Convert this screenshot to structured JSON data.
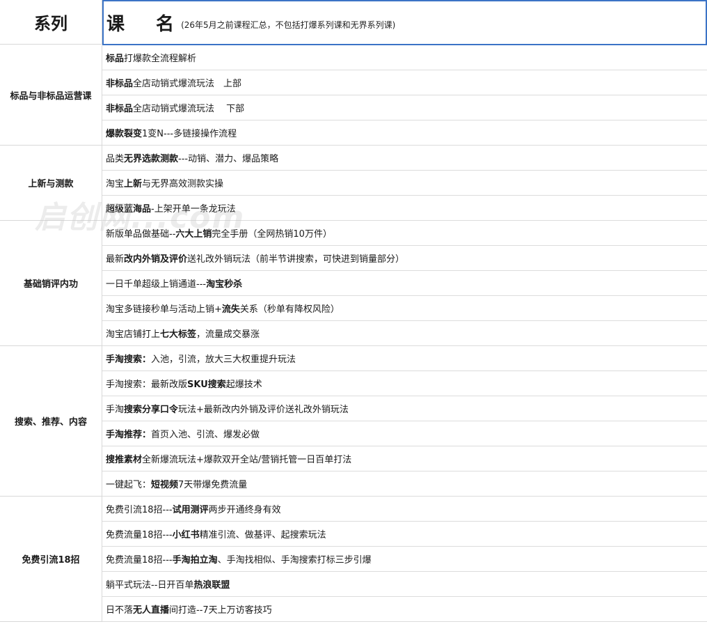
{
  "header": {
    "series_label": "系列",
    "course_label": "课 名",
    "course_note": "(26年5月之前课程汇总，不包括打爆系列课和无界系列课)"
  },
  "watermark": "启创网...com",
  "groups": [
    {
      "name": "标品与非标品运营课",
      "rows": [
        [
          {
            "t": "标品",
            "b": true
          },
          {
            "t": "打爆款全流程解析"
          }
        ],
        [
          {
            "t": "非标品",
            "b": true
          },
          {
            "t": "全店动销式爆流玩法　上部"
          }
        ],
        [
          {
            "t": "非标品",
            "b": true
          },
          {
            "t": "全店动销式爆流玩法　 下部"
          }
        ],
        [
          {
            "t": "爆款裂变",
            "b": true
          },
          {
            "t": "1变N---多链接操作流程"
          }
        ]
      ]
    },
    {
      "name": "上新与测款",
      "rows": [
        [
          {
            "t": "品类"
          },
          {
            "t": "无界选款测款",
            "b": true
          },
          {
            "t": "---动销、潜力、爆品策略"
          }
        ],
        [
          {
            "t": "淘宝"
          },
          {
            "t": "上新",
            "b": true
          },
          {
            "t": "与无界高效测款实操"
          }
        ],
        [
          {
            "t": "超级蓝海品",
            "b": true
          },
          {
            "t": "-上架开单一条龙玩法"
          }
        ]
      ]
    },
    {
      "name": "基础销评内功",
      "rows": [
        [
          {
            "t": "新版单品做基础--"
          },
          {
            "t": "六大上销",
            "b": true
          },
          {
            "t": "完全手册（全网热销10万件）"
          }
        ],
        [
          {
            "t": "最新"
          },
          {
            "t": "改内外销及评价",
            "b": true
          },
          {
            "t": "送礼改外销玩法（前半节讲搜索，可快进到销量部分）"
          }
        ],
        [
          {
            "t": "一日千单超级上销通道---"
          },
          {
            "t": "淘宝秒杀",
            "b": true
          }
        ],
        [
          {
            "t": "淘宝多链接秒单与活动上销+"
          },
          {
            "t": "流失",
            "b": true
          },
          {
            "t": "关系（秒单有降权风险）"
          }
        ],
        [
          {
            "t": "淘宝店铺打上"
          },
          {
            "t": "七大标签",
            "b": true
          },
          {
            "t": "，流量成交暴涨"
          }
        ]
      ]
    },
    {
      "name": "搜索、推荐、内容",
      "rows": [
        [
          {
            "t": "手淘搜索：",
            "b": true
          },
          {
            "t": "入池，引流，放大三大权重提升玩法"
          }
        ],
        [
          {
            "t": "手淘搜索：最新改版"
          },
          {
            "t": "SKU搜索",
            "b": true
          },
          {
            "t": "起爆技术"
          }
        ],
        [
          {
            "t": "手淘"
          },
          {
            "t": "搜索分享口令",
            "b": true
          },
          {
            "t": "玩法+最新改内外销及评价送礼改外销玩法"
          }
        ],
        [
          {
            "t": "手淘推荐：",
            "b": true
          },
          {
            "t": "首页入池、引流、爆发必做"
          }
        ],
        [
          {
            "t": "搜推素材",
            "b": true
          },
          {
            "t": "全新爆流玩法+爆款双开全站/营销托管一日百单打法"
          }
        ],
        [
          {
            "t": "一键起飞："
          },
          {
            "t": "短视频",
            "b": true
          },
          {
            "t": "7天带爆免费流量"
          }
        ]
      ]
    },
    {
      "name": "免费引流18招",
      "rows": [
        [
          {
            "t": "免费引流18招---"
          },
          {
            "t": "试用测评",
            "b": true
          },
          {
            "t": "两步开通终身有效"
          }
        ],
        [
          {
            "t": "免费流量18招---"
          },
          {
            "t": "小红书",
            "b": true
          },
          {
            "t": "精准引流、做基评、起搜索玩法"
          }
        ],
        [
          {
            "t": "免费流量18招---"
          },
          {
            "t": "手淘拍立淘",
            "b": true
          },
          {
            "t": "、手淘找相似、手淘搜索打标三步引爆"
          }
        ],
        [
          {
            "t": "躺平式玩法--日开百单"
          },
          {
            "t": "热浪联盟",
            "b": true
          }
        ],
        [
          {
            "t": "日不落"
          },
          {
            "t": "无人直播",
            "b": true
          },
          {
            "t": "间打造--7天上万访客技巧"
          }
        ]
      ]
    }
  ]
}
